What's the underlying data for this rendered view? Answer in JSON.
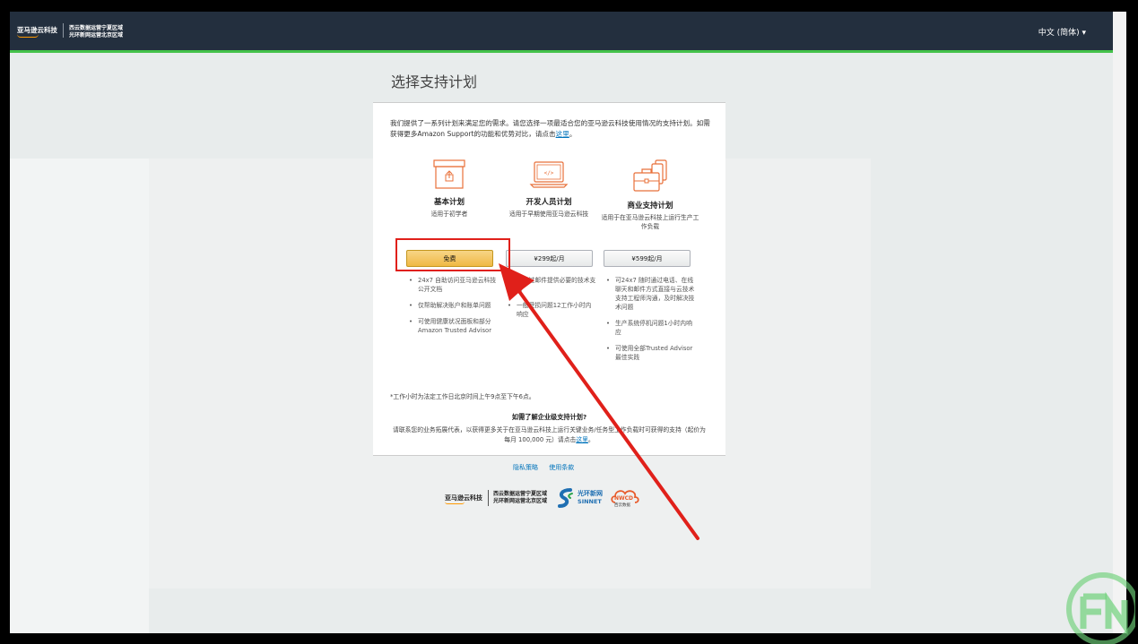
{
  "header": {
    "logo_main": "亚马逊云科技",
    "logo_line1": "西云数据运营宁夏区域",
    "logo_line2": "光环新网运营北京区域",
    "language": "中文 (简体)",
    "language_icon": "caret-down-icon"
  },
  "page": {
    "title": "选择支持计划",
    "intro_text": "我们提供了一系列计划来满足您的需求。请您选择一项最适合您的亚马逊云科技使用情况的支持计划。如需获得更多Amazon Support的功能和优势对比，请点击",
    "intro_link": "这里",
    "intro_end": "。"
  },
  "plans": [
    {
      "icon": "box-icon",
      "name": "基本计划",
      "desc": "适用于初学者",
      "button": "免费",
      "features": [
        "24x7 自助访问亚马逊云科技公开文档",
        "仅帮助解决账户和账单问题",
        "可使用健康状况面板和部分Amazon Trusted Advisor"
      ]
    },
    {
      "icon": "laptop-code-icon",
      "name": "开发人员计划",
      "desc": "适用于早期使用亚马逊云科技",
      "button": "¥299起/月",
      "features": [
        "仅通过邮件提供必要的技术支持",
        "一般受损问题12工作小时内响应"
      ]
    },
    {
      "icon": "briefcase-phone-icon",
      "name": "商业支持计划",
      "desc": "适用于在亚马逊云科技上运行生产工作负载",
      "button": "¥599起/月",
      "features": [
        "可24x7 随时通过电话、在线聊天和邮件方式直接与云技术支持工程师沟通，及时解决技术问题",
        "生产系统停机问题1小时内响应",
        "可使用全部Trusted Advisor最佳实践"
      ]
    }
  ],
  "note": "*工作小时为法定工作日北京时间上午9点至下午6点。",
  "enterprise": {
    "title": "如需了解企业级支持计划?",
    "text": "请联系您的业务拓展代表，以获得更多关于在亚马逊云科技上运行关键业务/任务型工作负载时可获得的支持（起价为每月 100,000 元）请点击",
    "link": "这里",
    "end": "。"
  },
  "footer": {
    "privacy": "隐私策略",
    "terms": "使用条款",
    "amz": "亚马逊云科技",
    "line1": "西云数据运营宁夏区域",
    "line2": "光环新网运营北京区域",
    "sinnet_cn": "光环新网",
    "sinnet_en": "SINNET",
    "nwcd": "NWCD",
    "nwcd_cn": "西云数据"
  },
  "colors": {
    "topbar": "#232f3e",
    "accent_green": "#44c24a",
    "link_blue": "#0073bb",
    "free_button": "#f0b944",
    "annotation_red": "#e0201a"
  }
}
